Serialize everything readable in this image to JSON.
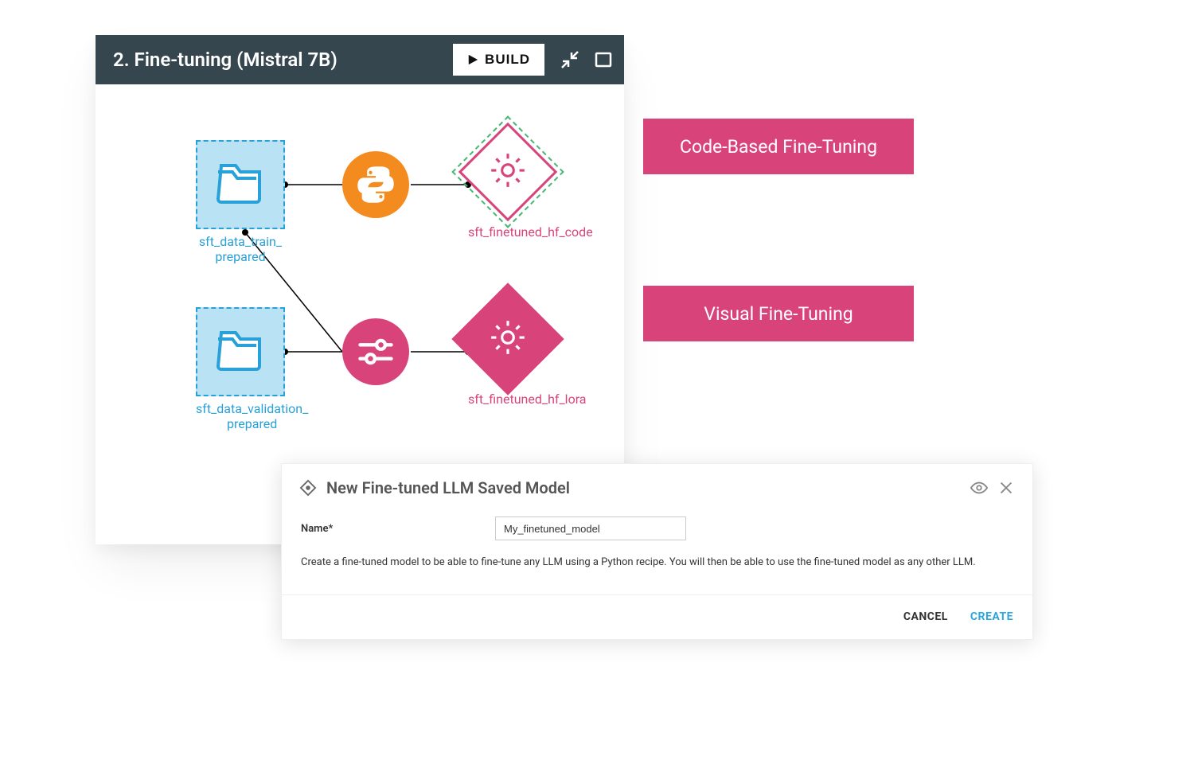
{
  "flow": {
    "title": "2. Fine-tuning (Mistral 7B)",
    "build_label": "BUILD",
    "nodes": {
      "train_prepared": "sft_data_train_\nprepared",
      "validation_prepared": "sft_data_validation_\nprepared",
      "finetuned_code": "sft_finetuned_hf_code",
      "finetuned_lora": "sft_finetuned_hf_lora"
    }
  },
  "labels": {
    "code_based": "Code-Based Fine-Tuning",
    "visual": "Visual Fine-Tuning"
  },
  "modal": {
    "title": "New Fine-tuned LLM Saved Model",
    "name_label": "Name*",
    "name_value": "My_finetuned_model",
    "description": "Create a fine-tuned model to be able to fine-tune any LLM using a Python recipe. You will then be able to use the fine-tuned model as any other LLM.",
    "cancel": "CANCEL",
    "create": "CREATE"
  }
}
